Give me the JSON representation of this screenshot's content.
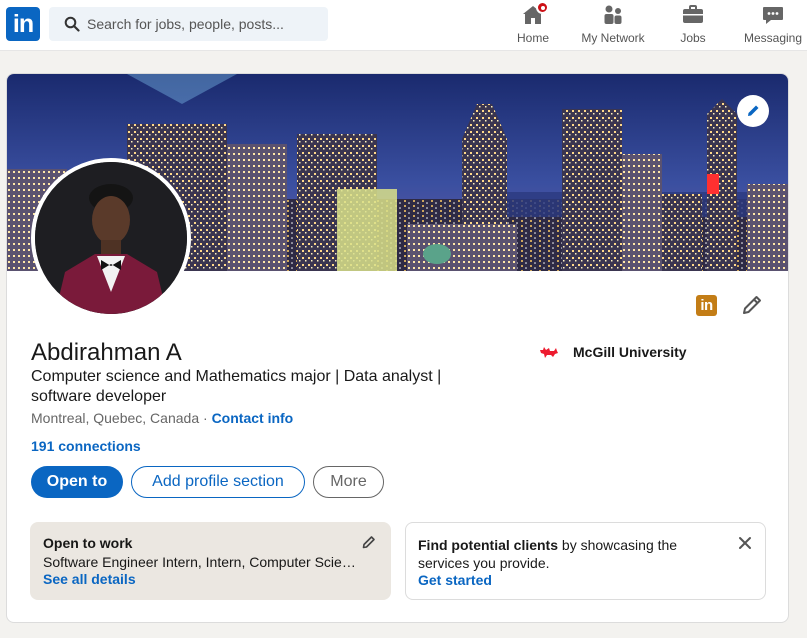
{
  "nav": {
    "logo_text": "in",
    "search_placeholder": "Search for jobs, people, posts...",
    "items": [
      {
        "label": "Home",
        "icon": "home-icon",
        "has_badge": true
      },
      {
        "label": "My Network",
        "icon": "network-icon"
      },
      {
        "label": "Jobs",
        "icon": "briefcase-icon"
      },
      {
        "label": "Messaging",
        "icon": "messaging-icon"
      }
    ]
  },
  "profile": {
    "name": "Abdirahman A",
    "headline": "Computer science and Mathematics major | Data analyst | software developer",
    "location": "Montreal, Quebec, Canada",
    "separator": " · ",
    "contact_info": "Contact info",
    "connections": "191 connections",
    "school": "McGill University",
    "brand_icon_text": "in"
  },
  "actions": {
    "open_to": "Open to",
    "add_section": "Add profile section",
    "more": "More"
  },
  "open_to_work": {
    "title": "Open to work",
    "detail": "Software Engineer Intern, Intern, Computer Science Intern",
    "link": "See all details"
  },
  "clients": {
    "bold": "Find potential clients",
    "rest": " by showcasing the services you provide.",
    "link": "Get started"
  },
  "colors": {
    "brand_blue": "#0a66c2",
    "badge_red": "#cc1016",
    "premium_gold": "#c37d16",
    "open_to_work_bg": "#ebe7e1"
  }
}
